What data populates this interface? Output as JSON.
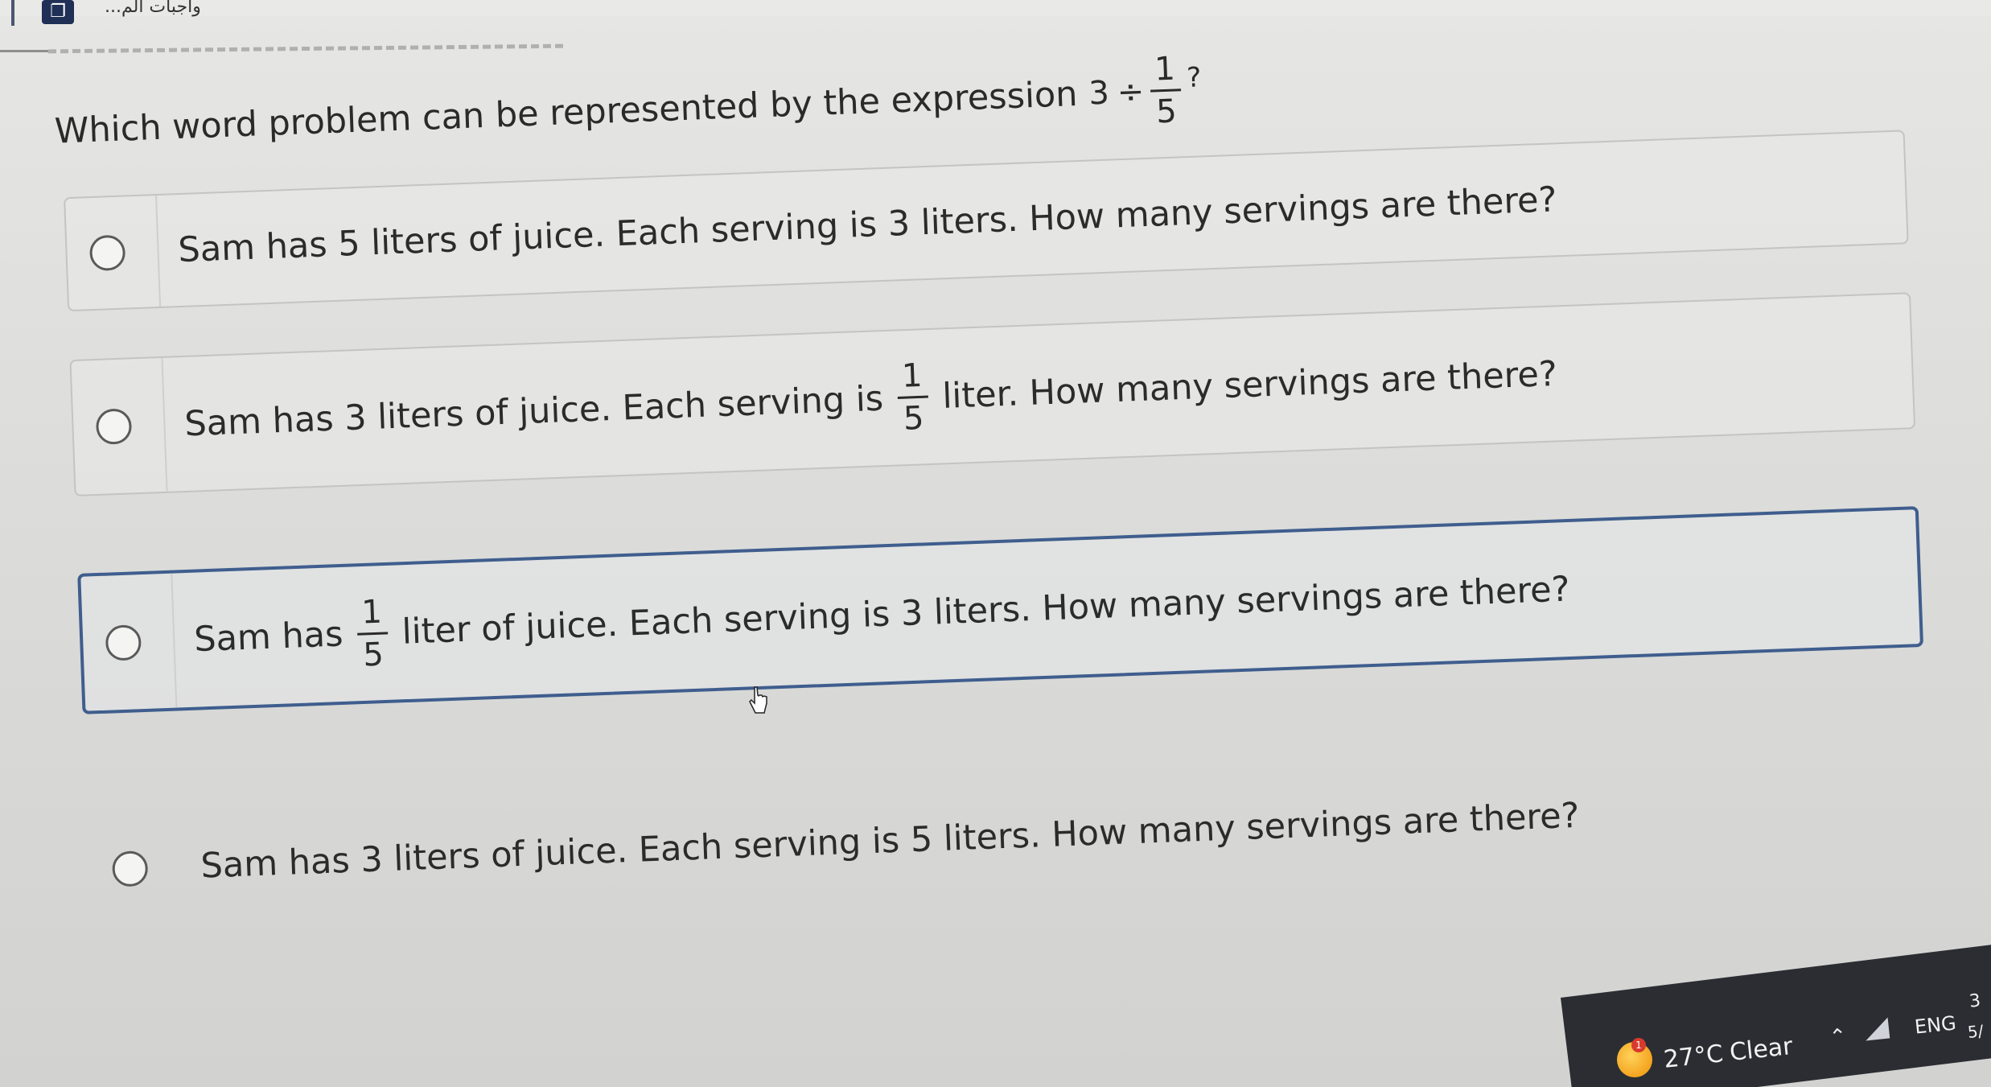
{
  "tab": {
    "title": "...واجبات الم",
    "icon": "app-logo-icon"
  },
  "question": {
    "prefix": "Which word problem can be represented by the expression",
    "expr_whole": "3",
    "expr_op": "÷",
    "expr_num": "1",
    "expr_den": "5",
    "expr_suffix": "?"
  },
  "options": [
    {
      "text": "Sam has 5 liters of juice. Each serving is 3 liters. How many servings are there?",
      "selected": false
    },
    {
      "text_before": "Sam has 3 liters of juice. Each serving is",
      "frac_num": "1",
      "frac_den": "5",
      "text_after": "liter. How many servings are there?",
      "selected": false
    },
    {
      "text_before": "Sam has",
      "frac_num": "1",
      "frac_den": "5",
      "text_after": "liter of juice. Each serving is 3 liters. How many servings are there?",
      "selected": true
    },
    {
      "text": "Sam has 3 liters of juice. Each serving is 5 liters. How many servings are there?",
      "selected": false
    }
  ],
  "taskbar": {
    "weather_badge": "1",
    "temperature": "27°C",
    "condition": "Clear",
    "language": "ENG",
    "clock_fragment_top": "3",
    "clock_fragment_bottom": "5/"
  },
  "colors": {
    "selected_border": "#3f5e8e",
    "taskbar": "#2b2d33"
  }
}
